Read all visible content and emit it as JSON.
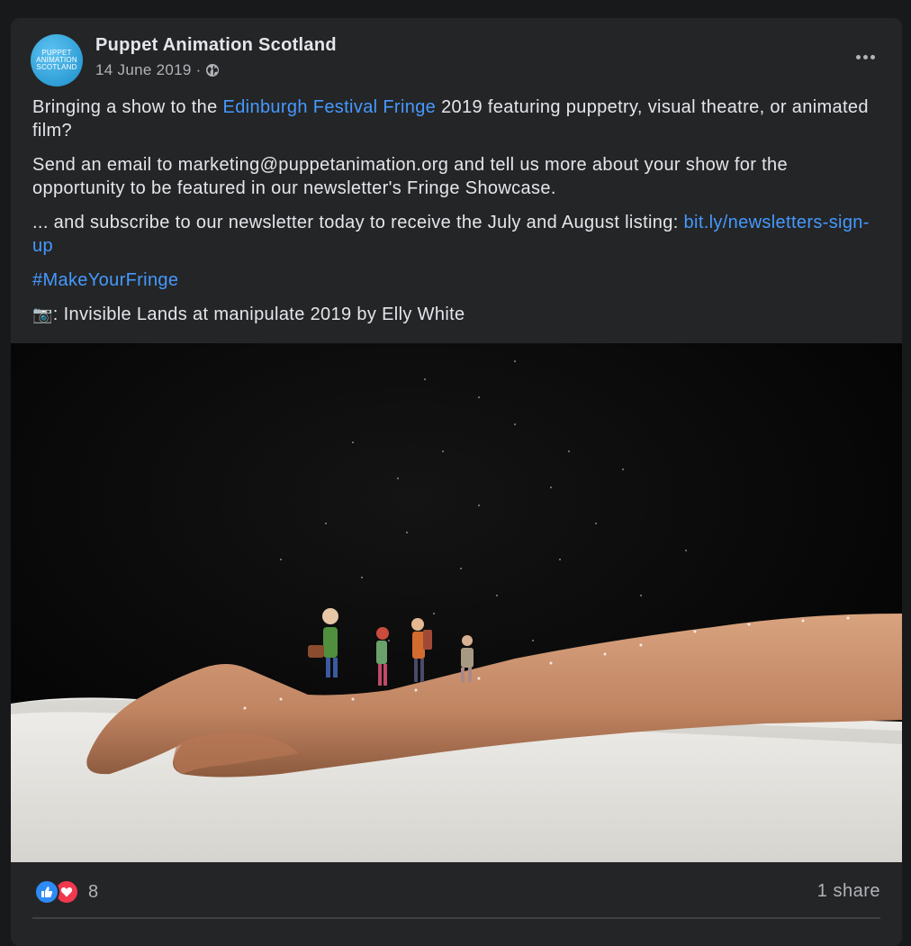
{
  "post": {
    "page_name": "Puppet Animation Scotland",
    "avatar_text": "PUPPET ANIMATION SCOTLAND",
    "date": "14 June 2019",
    "separator": "·",
    "privacy_icon": "globe-icon",
    "more_icon": "more-options-icon",
    "text": {
      "p1_before": "Bringing a show to the ",
      "p1_link": "Edinburgh Festival Fringe",
      "p1_after": " 2019 featuring puppetry, visual theatre, or animated film?",
      "p2": "Send an email to marketing@puppetanimation.org and tell us more about your show for the opportunity to be featured in our newsletter's Fringe Showcase.",
      "p3_before": "... and subscribe to our newsletter today to receive the July and August listing: ",
      "p3_link": "bit.ly/newsletters-sign-up",
      "hashtag": "#MakeYourFringe",
      "caption_icon": "📷",
      "caption": ": Invisible Lands at manipulate 2019 by Elly White"
    },
    "photo": {
      "subject": "miniature travellers walking along a forearm under falling water droplets"
    },
    "footer": {
      "reaction_icons": [
        "like-icon",
        "love-icon"
      ],
      "reaction_count": "8",
      "share_count": "1 share"
    }
  },
  "colors": {
    "page_bg": "#18191a",
    "card_bg": "#242526",
    "primary_text": "#e4e6eb",
    "secondary_text": "#b0b3b8",
    "link": "#4599ff",
    "like": "#2e8bf5",
    "love": "#f0384f"
  }
}
